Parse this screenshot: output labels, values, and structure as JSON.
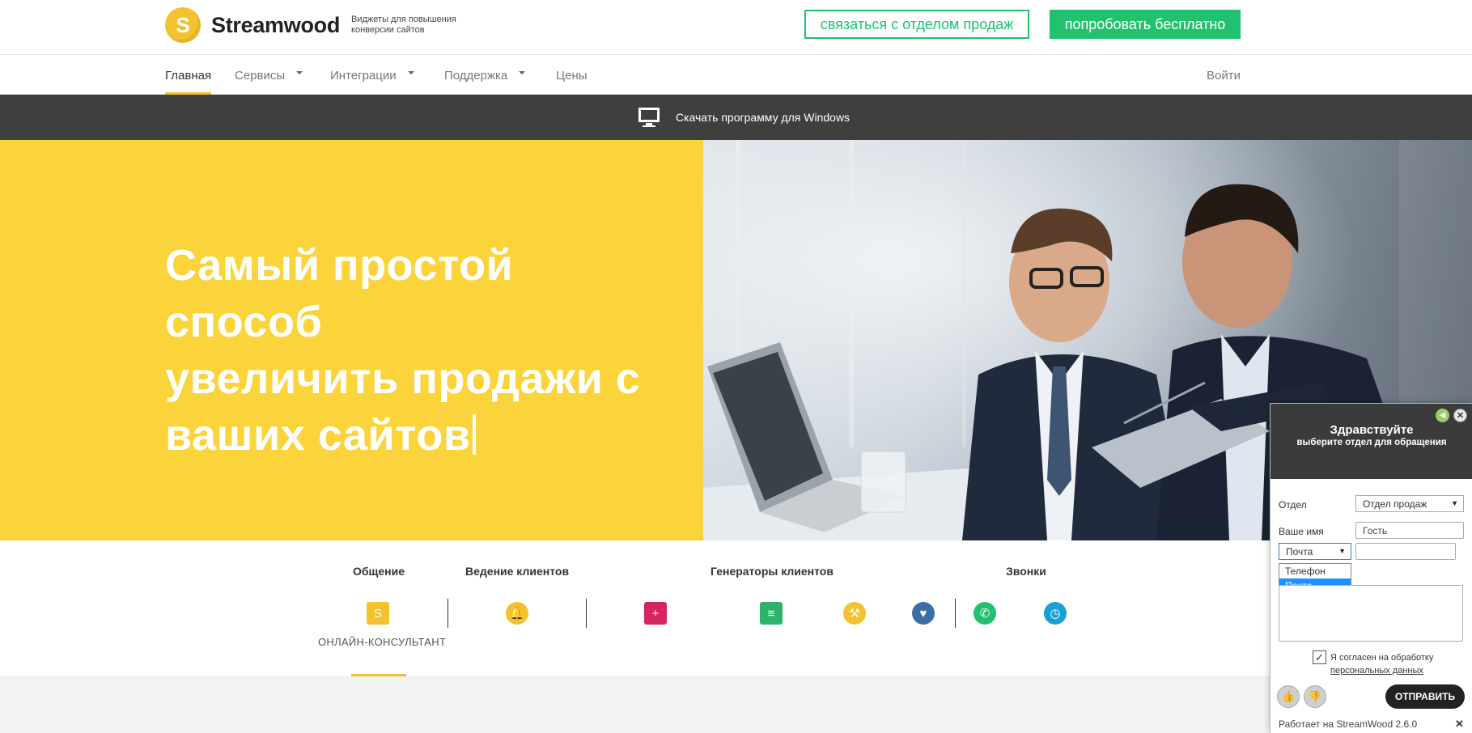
{
  "header": {
    "logo_letter": "S",
    "brand": "Streamwood",
    "tagline": "Виджеты для повышения конверсии сайтов",
    "contact_sales": "связаться с отделом продаж",
    "try_free": "попробовать бесплатно"
  },
  "nav": {
    "items": [
      "Главная",
      "Сервисы",
      "Интеграции",
      "Поддержка",
      "Цены"
    ],
    "login": "Войти"
  },
  "download_bar": {
    "text": "Скачать программу для Windows",
    "icon": "monitor-icon"
  },
  "hero": {
    "title_lines": [
      "Самый простой способ",
      "увеличить продажи с",
      "ваших сайтов"
    ]
  },
  "features": {
    "categories": [
      "Общение",
      "Ведение клиентов",
      "Генераторы клиентов",
      "Звонки"
    ],
    "active_label": "ОНЛАЙН-КОНСУЛЬТАНТ",
    "icons": [
      {
        "name": "chat-icon",
        "color": "#f4c22f",
        "glyph": "S"
      },
      {
        "name": "bell-icon",
        "color": "#f4c22f",
        "glyph": "🔔"
      },
      {
        "name": "add-client-icon",
        "color": "#d6245f",
        "glyph": "+"
      },
      {
        "name": "form-icon",
        "color": "#2fb36b",
        "glyph": "≡"
      },
      {
        "name": "auction-icon",
        "color": "#f4c22f",
        "glyph": "⚒"
      },
      {
        "name": "heart-icon",
        "color": "#3a6ea5",
        "glyph": "♥"
      },
      {
        "name": "callback-icon",
        "color": "#21c16f",
        "glyph": "✆"
      },
      {
        "name": "call-timer-icon",
        "color": "#1a9fd6",
        "glyph": "◷"
      }
    ]
  },
  "widget": {
    "title": "Здравствуйте",
    "subtitle": "выберите отдел для обращения",
    "dept_label": "Отдел",
    "dept_value": "Отдел продаж",
    "name_label": "Ваше имя",
    "name_value": "Гость",
    "contact_type_value": "Почта",
    "contact_options": [
      "Телефон",
      "Почта"
    ],
    "consent_text": "Я согласен на обработку",
    "consent_link": "персональных данных",
    "send": "ОТПРАВИТЬ",
    "footer": "Работает на StreamWood 2.6.0"
  }
}
